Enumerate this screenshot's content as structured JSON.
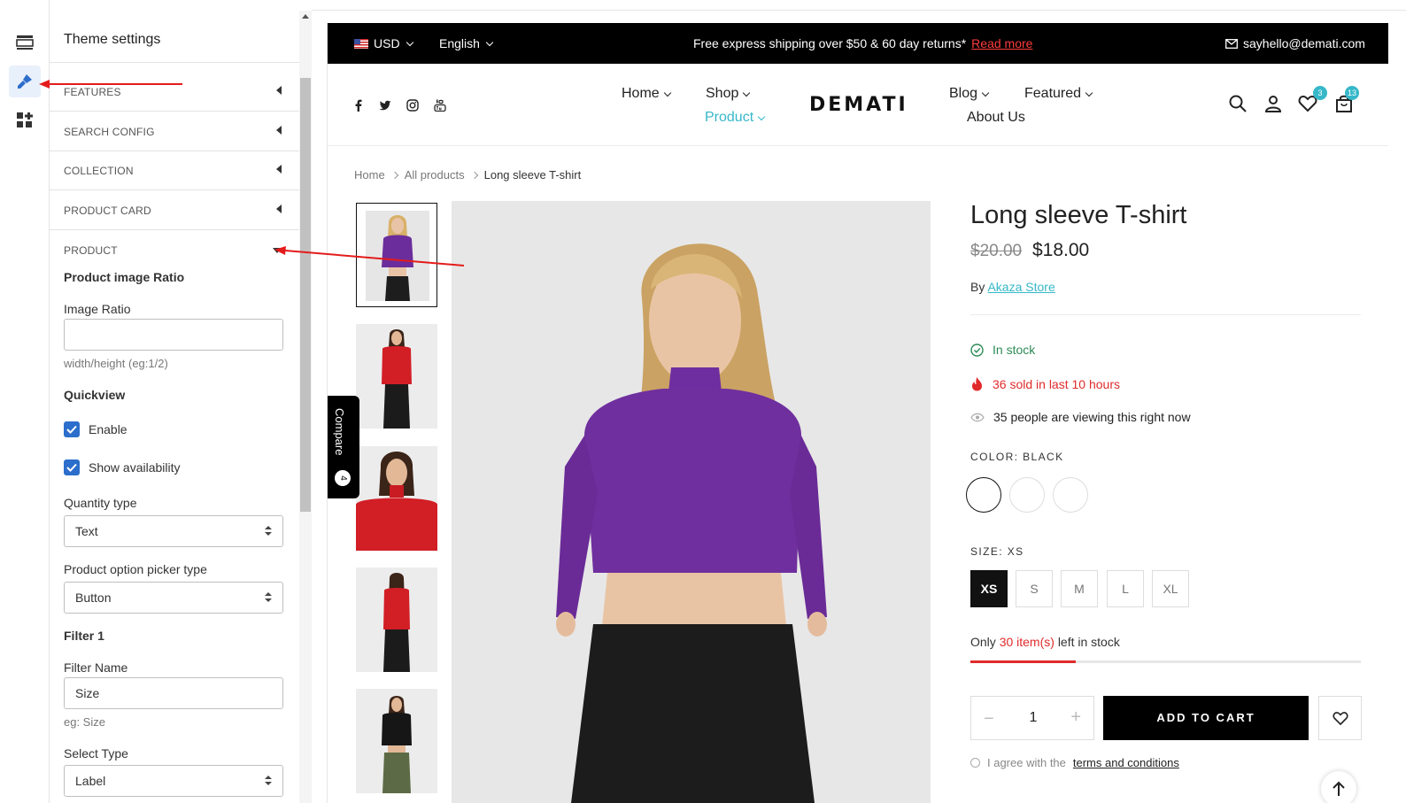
{
  "panel": {
    "title": "Theme settings",
    "sections": [
      "FEATURES",
      "SEARCH CONFIG",
      "COLLECTION",
      "PRODUCT CARD",
      "PRODUCT"
    ],
    "product_image_ratio_heading": "Product image Ratio",
    "image_ratio_label": "Image Ratio",
    "image_ratio_value": "",
    "image_ratio_hint": "width/height (eg:1/2)",
    "quickview_heading": "Quickview",
    "enable_label": "Enable",
    "show_availability_label": "Show availability",
    "quantity_type_label": "Quantity type",
    "quantity_type_value": "Text",
    "option_picker_label": "Product option picker type",
    "option_picker_value": "Button",
    "filter1_heading": "Filter 1",
    "filter_name_label": "Filter Name",
    "filter_name_value": "Size",
    "filter_name_hint": "eg: Size",
    "select_type_label": "Select Type",
    "select_type_value": "Label"
  },
  "announcement": {
    "currency": "USD",
    "language": "English",
    "message": "Free express shipping over $50 & 60 day returns*",
    "read_more": "Read more",
    "email": "sayhello@demati.com"
  },
  "header": {
    "nav_left": [
      "Home",
      "Shop",
      "Product"
    ],
    "logo": "DEMATI",
    "nav_right": [
      "Blog",
      "Featured",
      "About Us"
    ],
    "wishlist_count": "3",
    "cart_count": "13"
  },
  "breadcrumb": [
    "Home",
    "All products",
    "Long sleeve T-shirt"
  ],
  "compare": {
    "label": "Compare",
    "count": "4"
  },
  "product": {
    "title": "Long sleeve T-shirt",
    "old_price": "$20.00",
    "price": "$18.00",
    "by_label": "By",
    "vendor": "Akaza Store",
    "in_stock": "In stock",
    "sold_text": "36 sold in last 10 hours",
    "viewing_text": "35 people are viewing this right now",
    "color_label": "COLOR:",
    "color_value": "BLACK",
    "size_label": "SIZE:",
    "size_value": "XS",
    "sizes": [
      "XS",
      "S",
      "M",
      "L",
      "XL"
    ],
    "stock_prefix": "Only",
    "stock_count": "30 item(s)",
    "stock_suffix": "left in stock",
    "stock_fraction": 0.27,
    "quantity": "1",
    "qty_minus": "−",
    "qty_plus": "+",
    "add_to_cart": "ADD TO CART",
    "terms_prefix": "I agree with the",
    "terms_link": "terms and conditions"
  },
  "colors": {
    "accent": "#36b8c9",
    "sale": "#e02b2b",
    "instock": "#2e8b57",
    "editor_blue": "#2c6ecb"
  }
}
